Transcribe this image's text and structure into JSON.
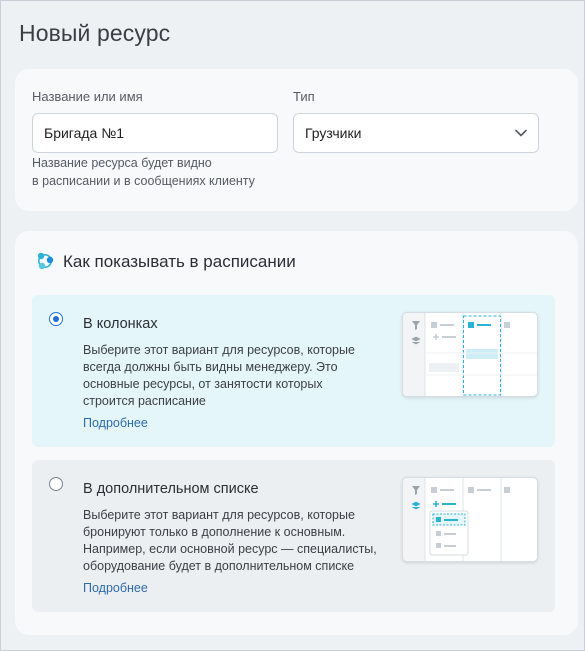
{
  "page": {
    "title": "Новый ресурс"
  },
  "form": {
    "name_label": "Название или имя",
    "name_value": "Бригада №1",
    "type_label": "Тип",
    "type_value": "Грузчики",
    "hint_line1": "Название ресурса будет видно",
    "hint_line2": "в расписании и в сообщениях клиенту"
  },
  "display": {
    "title": "Как показывать в расписании",
    "options": [
      {
        "title": "В колонках",
        "desc_lines": [
          "Выберите этот вариант для ресурсов, которые",
          "всегда должны быть видны менеджеру. Это",
          "основные ресурсы, от занятости которых",
          "строится расписание"
        ],
        "link": "Подробнее",
        "selected": true
      },
      {
        "title": "В дополнительном списке",
        "desc_lines": [
          "Выберите этот вариант для ресурсов, которые",
          "бронируют только в дополнение к основным.",
          "Например, если основной ресурс — специалисты,",
          "оборудование будет в дополнительном списке"
        ],
        "link": "Подробнее",
        "selected": false
      }
    ]
  },
  "colors": {
    "accent": "#1e6fd9",
    "teal": "#2bb3d6",
    "selected_bg": "#e4f6fa",
    "link": "#2d6aa8"
  }
}
